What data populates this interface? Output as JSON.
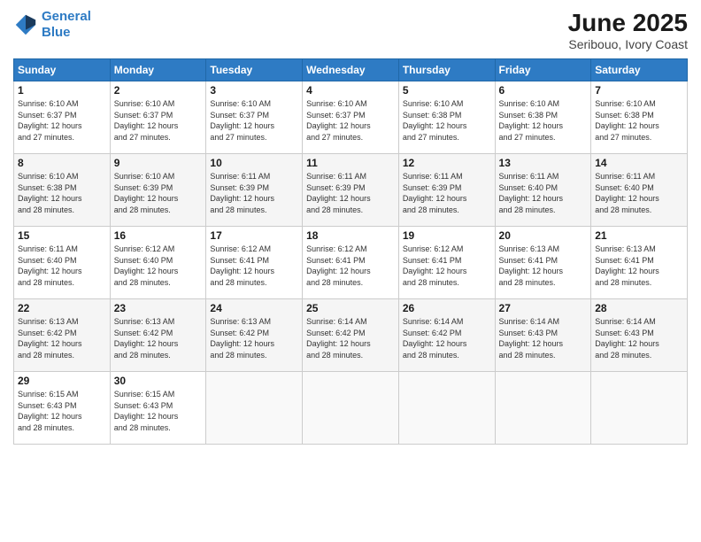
{
  "header": {
    "logo_line1": "General",
    "logo_line2": "Blue",
    "title": "June 2025",
    "subtitle": "Seribouo, Ivory Coast"
  },
  "days_of_week": [
    "Sunday",
    "Monday",
    "Tuesday",
    "Wednesday",
    "Thursday",
    "Friday",
    "Saturday"
  ],
  "weeks": [
    [
      {
        "day": "1",
        "info": "Sunrise: 6:10 AM\nSunset: 6:37 PM\nDaylight: 12 hours\nand 27 minutes."
      },
      {
        "day": "2",
        "info": "Sunrise: 6:10 AM\nSunset: 6:37 PM\nDaylight: 12 hours\nand 27 minutes."
      },
      {
        "day": "3",
        "info": "Sunrise: 6:10 AM\nSunset: 6:37 PM\nDaylight: 12 hours\nand 27 minutes."
      },
      {
        "day": "4",
        "info": "Sunrise: 6:10 AM\nSunset: 6:37 PM\nDaylight: 12 hours\nand 27 minutes."
      },
      {
        "day": "5",
        "info": "Sunrise: 6:10 AM\nSunset: 6:38 PM\nDaylight: 12 hours\nand 27 minutes."
      },
      {
        "day": "6",
        "info": "Sunrise: 6:10 AM\nSunset: 6:38 PM\nDaylight: 12 hours\nand 27 minutes."
      },
      {
        "day": "7",
        "info": "Sunrise: 6:10 AM\nSunset: 6:38 PM\nDaylight: 12 hours\nand 27 minutes."
      }
    ],
    [
      {
        "day": "8",
        "info": "Sunrise: 6:10 AM\nSunset: 6:38 PM\nDaylight: 12 hours\nand 28 minutes."
      },
      {
        "day": "9",
        "info": "Sunrise: 6:10 AM\nSunset: 6:39 PM\nDaylight: 12 hours\nand 28 minutes."
      },
      {
        "day": "10",
        "info": "Sunrise: 6:11 AM\nSunset: 6:39 PM\nDaylight: 12 hours\nand 28 minutes."
      },
      {
        "day": "11",
        "info": "Sunrise: 6:11 AM\nSunset: 6:39 PM\nDaylight: 12 hours\nand 28 minutes."
      },
      {
        "day": "12",
        "info": "Sunrise: 6:11 AM\nSunset: 6:39 PM\nDaylight: 12 hours\nand 28 minutes."
      },
      {
        "day": "13",
        "info": "Sunrise: 6:11 AM\nSunset: 6:40 PM\nDaylight: 12 hours\nand 28 minutes."
      },
      {
        "day": "14",
        "info": "Sunrise: 6:11 AM\nSunset: 6:40 PM\nDaylight: 12 hours\nand 28 minutes."
      }
    ],
    [
      {
        "day": "15",
        "info": "Sunrise: 6:11 AM\nSunset: 6:40 PM\nDaylight: 12 hours\nand 28 minutes."
      },
      {
        "day": "16",
        "info": "Sunrise: 6:12 AM\nSunset: 6:40 PM\nDaylight: 12 hours\nand 28 minutes."
      },
      {
        "day": "17",
        "info": "Sunrise: 6:12 AM\nSunset: 6:41 PM\nDaylight: 12 hours\nand 28 minutes."
      },
      {
        "day": "18",
        "info": "Sunrise: 6:12 AM\nSunset: 6:41 PM\nDaylight: 12 hours\nand 28 minutes."
      },
      {
        "day": "19",
        "info": "Sunrise: 6:12 AM\nSunset: 6:41 PM\nDaylight: 12 hours\nand 28 minutes."
      },
      {
        "day": "20",
        "info": "Sunrise: 6:13 AM\nSunset: 6:41 PM\nDaylight: 12 hours\nand 28 minutes."
      },
      {
        "day": "21",
        "info": "Sunrise: 6:13 AM\nSunset: 6:41 PM\nDaylight: 12 hours\nand 28 minutes."
      }
    ],
    [
      {
        "day": "22",
        "info": "Sunrise: 6:13 AM\nSunset: 6:42 PM\nDaylight: 12 hours\nand 28 minutes."
      },
      {
        "day": "23",
        "info": "Sunrise: 6:13 AM\nSunset: 6:42 PM\nDaylight: 12 hours\nand 28 minutes."
      },
      {
        "day": "24",
        "info": "Sunrise: 6:13 AM\nSunset: 6:42 PM\nDaylight: 12 hours\nand 28 minutes."
      },
      {
        "day": "25",
        "info": "Sunrise: 6:14 AM\nSunset: 6:42 PM\nDaylight: 12 hours\nand 28 minutes."
      },
      {
        "day": "26",
        "info": "Sunrise: 6:14 AM\nSunset: 6:42 PM\nDaylight: 12 hours\nand 28 minutes."
      },
      {
        "day": "27",
        "info": "Sunrise: 6:14 AM\nSunset: 6:43 PM\nDaylight: 12 hours\nand 28 minutes."
      },
      {
        "day": "28",
        "info": "Sunrise: 6:14 AM\nSunset: 6:43 PM\nDaylight: 12 hours\nand 28 minutes."
      }
    ],
    [
      {
        "day": "29",
        "info": "Sunrise: 6:15 AM\nSunset: 6:43 PM\nDaylight: 12 hours\nand 28 minutes."
      },
      {
        "day": "30",
        "info": "Sunrise: 6:15 AM\nSunset: 6:43 PM\nDaylight: 12 hours\nand 28 minutes."
      },
      {
        "day": "",
        "info": ""
      },
      {
        "day": "",
        "info": ""
      },
      {
        "day": "",
        "info": ""
      },
      {
        "day": "",
        "info": ""
      },
      {
        "day": "",
        "info": ""
      }
    ]
  ]
}
